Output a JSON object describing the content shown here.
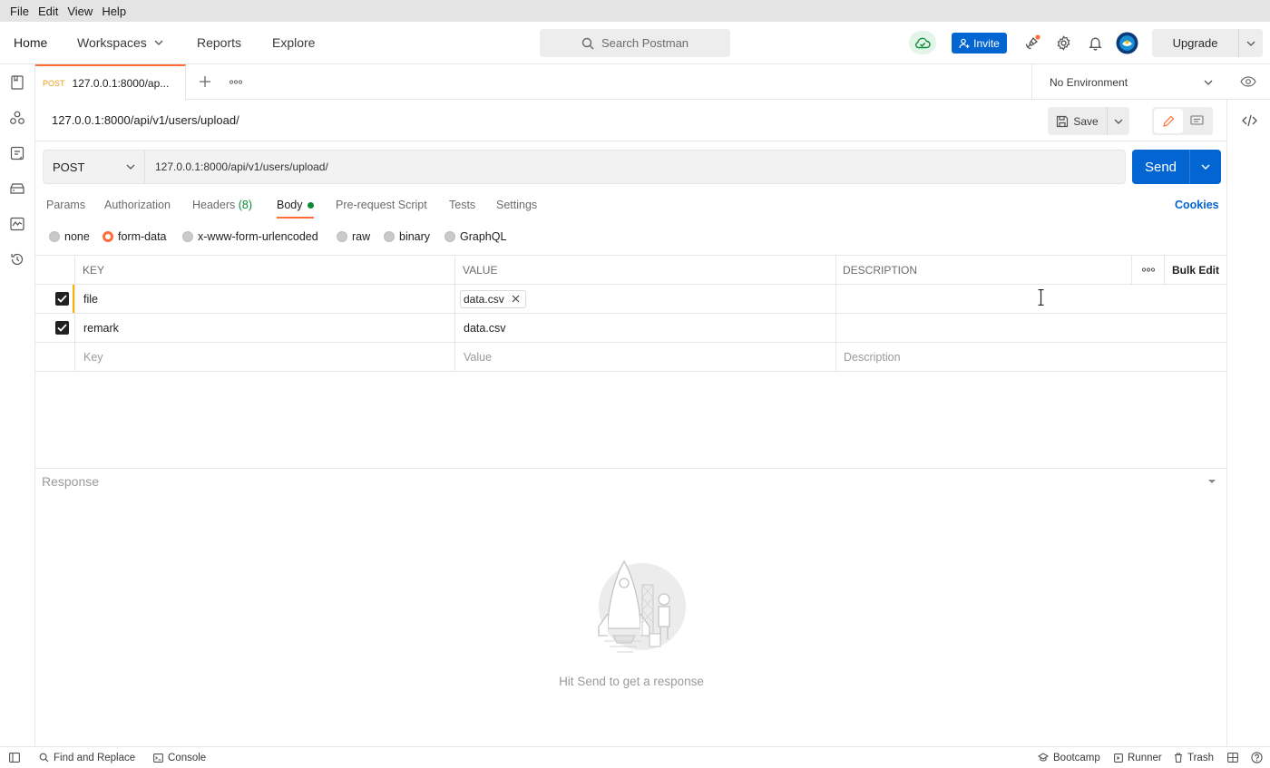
{
  "menu": [
    "File",
    "Edit",
    "View",
    "Help"
  ],
  "nav": {
    "home": "Home",
    "workspaces": "Workspaces",
    "reports": "Reports",
    "explore": "Explore"
  },
  "search": {
    "placeholder": "Search Postman"
  },
  "header": {
    "invite_label": "Invite",
    "upgrade_label": "Upgrade"
  },
  "tab": {
    "method": "POST",
    "title": "127.0.0.1:8000/ap..."
  },
  "environment": {
    "selected": "No Environment"
  },
  "request": {
    "title": "127.0.0.1:8000/api/v1/users/upload/",
    "method": "POST",
    "url": "127.0.0.1:8000/api/v1/users/upload/",
    "save_label": "Save",
    "send_label": "Send"
  },
  "request_tabs": {
    "params": "Params",
    "authorization": "Authorization",
    "headers": "Headers",
    "headers_count": "(8)",
    "body": "Body",
    "prerequest": "Pre-request Script",
    "tests": "Tests",
    "settings": "Settings",
    "cookies": "Cookies"
  },
  "body_types": {
    "none": "none",
    "formdata": "form-data",
    "urlencoded": "x-www-form-urlencoded",
    "raw": "raw",
    "binary": "binary",
    "graphql": "GraphQL",
    "selected": "form-data"
  },
  "table": {
    "headers": {
      "key": "KEY",
      "value": "VALUE",
      "description": "DESCRIPTION",
      "bulk_edit": "Bulk Edit"
    },
    "rows": [
      {
        "checked": true,
        "key": "file",
        "value": "data.csv",
        "value_type": "file",
        "description": ""
      },
      {
        "checked": true,
        "key": "remark",
        "value": "data.csv",
        "value_type": "text",
        "description": ""
      }
    ],
    "placeholders": {
      "key": "Key",
      "value": "Value",
      "description": "Description"
    }
  },
  "response": {
    "header": "Response",
    "hint": "Hit Send to get a response"
  },
  "footer": {
    "find_replace": "Find and Replace",
    "console": "Console",
    "bootcamp": "Bootcamp",
    "runner": "Runner",
    "trash": "Trash"
  },
  "colors": {
    "accent": "#ff6c37",
    "primary_blue": "#0265d2",
    "success_green": "#0b8a34",
    "post_method": "#e8a013"
  }
}
